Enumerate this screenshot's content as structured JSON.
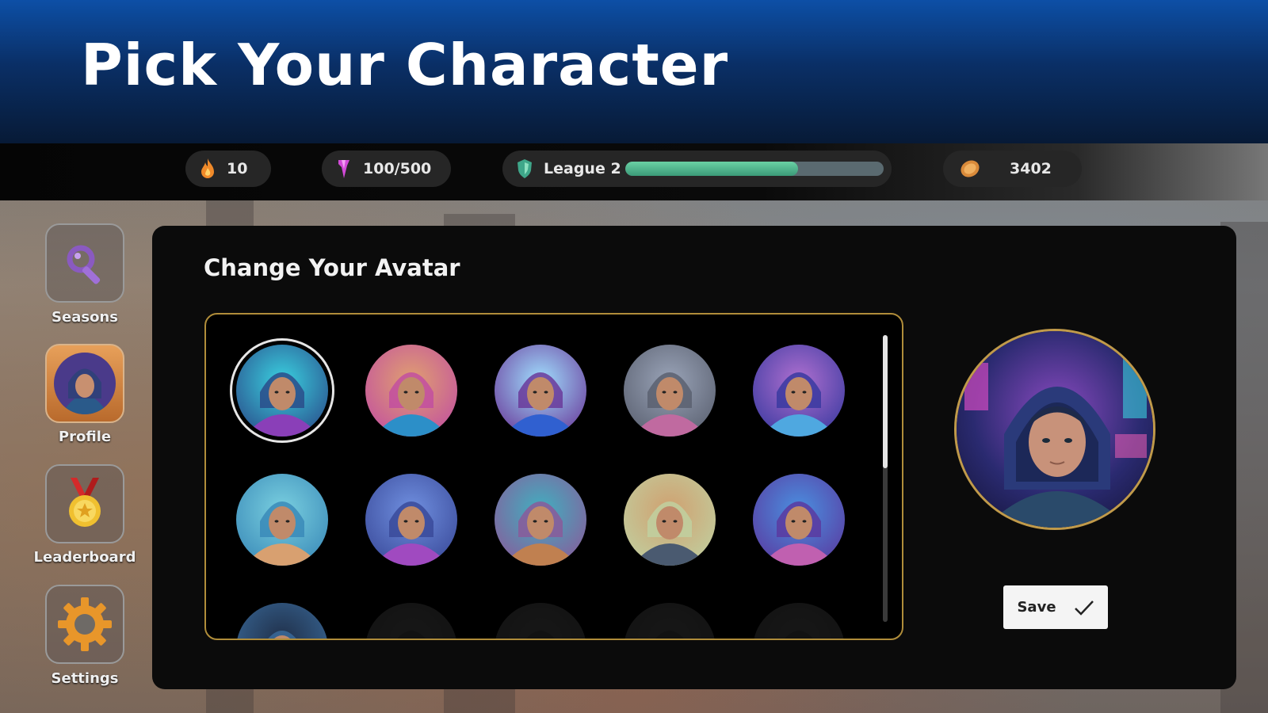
{
  "header": {
    "title": "Pick Your Character"
  },
  "stats": {
    "streak": {
      "icon": "flame-icon",
      "value": "10"
    },
    "energy": {
      "icon": "gem-icon",
      "value": "100/500"
    },
    "league": {
      "icon": "league-shield-icon",
      "label": "League 2",
      "progress": 0.67
    },
    "coins": {
      "icon": "coin-icon",
      "value": "3402"
    }
  },
  "sidebar": {
    "items": [
      {
        "label": "Seasons",
        "icon": "seasons-icon",
        "active": false
      },
      {
        "label": "Profile",
        "icon": "profile-avatar-icon",
        "active": true
      },
      {
        "label": "Leaderboard",
        "icon": "medal-icon",
        "active": false
      },
      {
        "label": "Settings",
        "icon": "gear-icon",
        "active": false
      }
    ]
  },
  "panel": {
    "title": "Change Your Avatar",
    "save_label": "Save",
    "avatars": [
      {
        "palette": [
          "#2a4c8a",
          "#8a3fb8",
          "#3ad1e0"
        ],
        "selected": true
      },
      {
        "palette": [
          "#c24fa0",
          "#2c8fc8",
          "#e0a070"
        ]
      },
      {
        "palette": [
          "#6a3a9a",
          "#3060d0",
          "#a0e0ff"
        ]
      },
      {
        "palette": [
          "#5a6070",
          "#c06aa0",
          "#9aa4b8"
        ]
      },
      {
        "palette": [
          "#3a3aa0",
          "#4fa8e0",
          "#b070d0"
        ]
      },
      {
        "palette": [
          "#3a8ab8",
          "#d8a070",
          "#7ad0e0"
        ]
      },
      {
        "palette": [
          "#3a4a9a",
          "#a04ac0",
          "#7090e0"
        ]
      },
      {
        "palette": [
          "#8a5a9a",
          "#c08050",
          "#40b0c0"
        ]
      },
      {
        "palette": [
          "#c0d0a0",
          "#4a5a70",
          "#d0a070"
        ]
      },
      {
        "palette": [
          "#5a3aa0",
          "#c060b0",
          "#4a90e0"
        ]
      },
      {
        "palette": [
          "#3a6a9a",
          "#8ab0d0",
          "#20304a"
        ]
      },
      {
        "palette": [
          "#333333",
          "#222222",
          "#444444"
        ],
        "locked": true
      },
      {
        "palette": [
          "#333333",
          "#222222",
          "#444444"
        ],
        "locked": true
      },
      {
        "palette": [
          "#333333",
          "#222222",
          "#444444"
        ],
        "locked": true
      },
      {
        "palette": [
          "#333333",
          "#222222",
          "#444444"
        ],
        "locked": true
      }
    ]
  },
  "colors": {
    "header_top": "#0d4fa6",
    "header_bottom": "#071a36",
    "panel_bg": "#0b0b0b",
    "frame_gold": "#b08d3a",
    "league_fill": "#4fb88d",
    "active_tab": "#e7a05a"
  }
}
